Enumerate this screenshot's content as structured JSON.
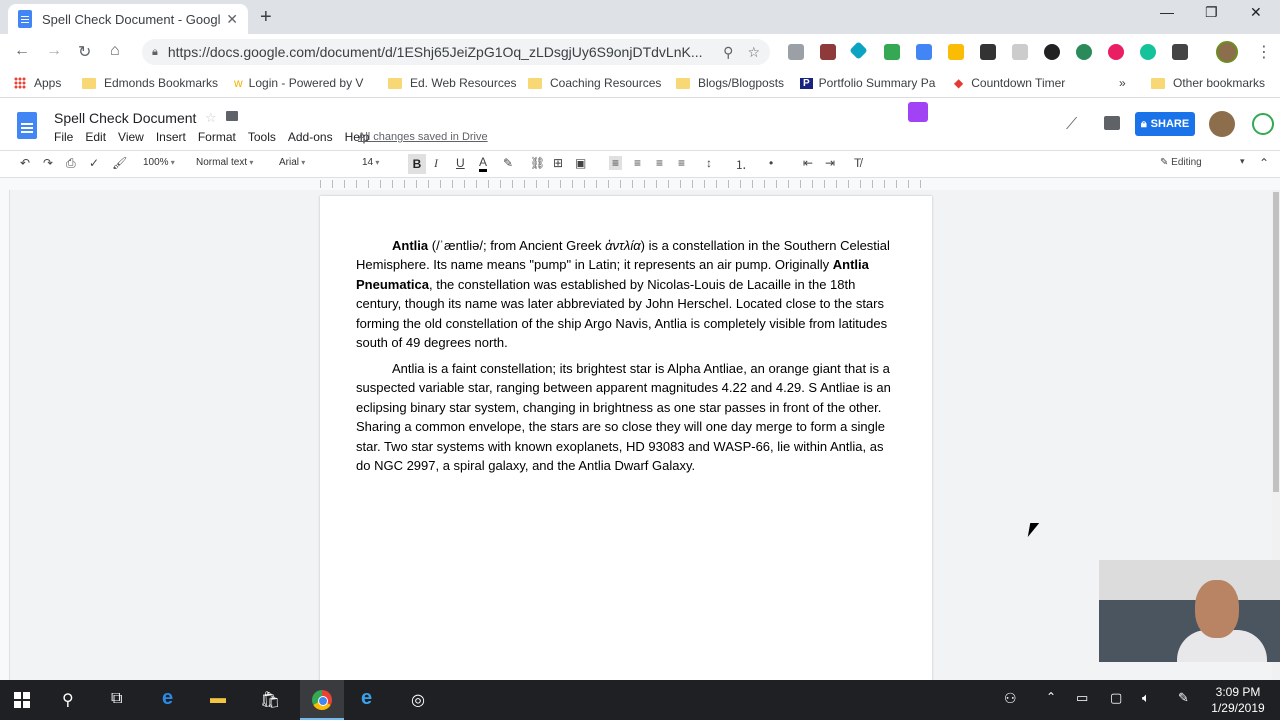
{
  "browser": {
    "tab_title": "Spell Check Document - Google",
    "url": "https://docs.google.com/document/d/1EShj65JeiZpG1Oq_zLDsgjUy6S9onjDTdvLnK...",
    "bookmarks": [
      "Apps",
      "Edmonds Bookmarks",
      "Login - Powered by V",
      "Ed. Web Resources",
      "Coaching Resources",
      "Blogs/Blogposts",
      "Portfolio Summary Pa",
      "Countdown Timer",
      "Other bookmarks"
    ],
    "bookmarks_overflow": "»"
  },
  "docs": {
    "title": "Spell Check Document",
    "menu": [
      "File",
      "Edit",
      "View",
      "Insert",
      "Format",
      "Tools",
      "Add-ons",
      "Help"
    ],
    "saved_message": "All changes saved in Drive",
    "share_label": "SHARE",
    "toolbar": {
      "zoom": "100%",
      "style": "Normal text",
      "font": "Arial",
      "size": "14",
      "mode": "Editing"
    }
  },
  "document": {
    "p1_t1": "Antlia",
    "p1_t2": " (/ˈæntliə/; from Ancient Greek ",
    "p1_t3": "ἀντλία",
    "p1_t4": ") is a constellation in the Southern Celestial Hemisphere. Its name means \"pump\" in Latin; it represents an air pump. Originally ",
    "p1_t5": "Antlia Pneumatica",
    "p1_t6": ", the constellation was established by Nicolas-Louis de Lacaille in the 18th century, though its name was later abbreviated by John Herschel. Located close to the stars forming the old constellation of the ship Argo Navis, Antlia is completely visible from latitudes south of 49 degrees north.",
    "p2": "Antlia is a faint constellation; its brightest star is Alpha Antliae, an orange giant that is a suspected variable star, ranging between apparent magnitudes 4.22 and 4.29. S Antliae is an eclipsing binary star system, changing in brightness as one star passes in front of the other. Sharing a common envelope, the stars are so close they will one day merge to form a single star. Two star systems with known exoplanets, HD 93083 and WASP-66, lie within Antlia, as do NGC 2997, a spiral galaxy, and the Antlia Dwarf Galaxy."
  },
  "taskbar": {
    "time": "3:09 PM",
    "date": "1/29/2019"
  }
}
